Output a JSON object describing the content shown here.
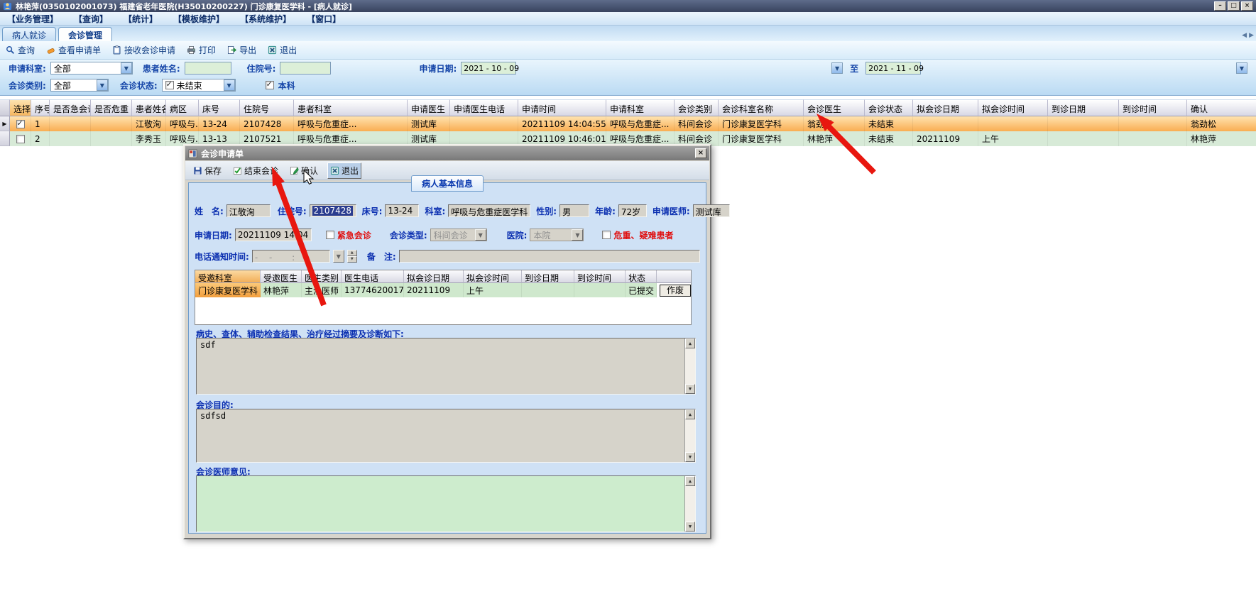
{
  "window": {
    "title": "林艳萍(0350102001073) 福建省老年医院(H35010200227) 门诊康复医学科 - [病人就诊]",
    "controls": {
      "minimize": "–",
      "maximize": "□",
      "close": "×"
    }
  },
  "menu": {
    "items": [
      "【业务管理】",
      "【查询】",
      "【统计】",
      "【模板维护】",
      "【系统维护】",
      "【窗口】"
    ]
  },
  "tabs": {
    "items": [
      {
        "label": "病人就诊"
      },
      {
        "label": "会诊管理"
      }
    ],
    "nav_prev": "◀",
    "nav_next": "▶"
  },
  "toolbar": {
    "buttons": [
      {
        "label": "查询",
        "icon": "search-icon"
      },
      {
        "label": "查看申请单",
        "icon": "view-form-icon"
      },
      {
        "label": "接收会诊申请",
        "icon": "receive-request-icon"
      },
      {
        "label": "打印",
        "icon": "print-icon"
      },
      {
        "label": "导出",
        "icon": "export-icon"
      },
      {
        "label": "退出",
        "icon": "exit-icon"
      }
    ]
  },
  "filters": {
    "apply_dept_label": "申请科室:",
    "apply_dept_value": "全部",
    "patient_name_label": "患者姓名:",
    "patient_name_value": "",
    "admission_no_label": "住院号:",
    "admission_no_value": "",
    "apply_date_label": "申请日期:",
    "date_from": "2021 - 10 - 09",
    "to_label": "至",
    "date_to": "2021 - 11 - 09",
    "consult_class_label": "会诊类别:",
    "consult_class_value": "全部",
    "consult_status_label": "会诊状态:",
    "consult_status_value": "未结束",
    "consult_status_checked": true,
    "own_dept_label": "本科",
    "own_dept_checked": true
  },
  "table": {
    "columns": [
      "选择",
      "序号",
      "是否急会诊",
      "是否危重",
      "患者姓名",
      "病区",
      "床号",
      "住院号",
      "患者科室",
      "申请医生",
      "申请医生电话",
      "申请时间",
      "申请科室",
      "会诊类别",
      "会诊科室名称",
      "会诊医生",
      "会诊状态",
      "拟会诊日期",
      "拟会诊时间",
      "到诊日期",
      "到诊时间",
      "确认"
    ],
    "rows": [
      {
        "checked": true,
        "current": true,
        "cells": [
          "1",
          "",
          "",
          "江敬洵",
          "呼吸与...",
          "13-24",
          "2107428",
          "呼吸与危重症...",
          "测试库",
          "",
          "20211109 14:04:55",
          "呼吸与危重症...",
          "科间会诊",
          "门诊康复医学科",
          "翁劲松",
          "未结束",
          "",
          "",
          "",
          "",
          "翁劲松"
        ]
      },
      {
        "checked": false,
        "current": false,
        "cells": [
          "2",
          "",
          "",
          "李秀玉",
          "呼吸与...",
          "13-13",
          "2107521",
          "呼吸与危重症...",
          "测试库",
          "",
          "20211109 10:46:01",
          "呼吸与危重症...",
          "科间会诊",
          "门诊康复医学科",
          "林艳萍",
          "未结束",
          "20211109",
          "上午",
          "",
          "",
          "林艳萍"
        ]
      }
    ]
  },
  "dialog": {
    "title": "会诊申请单",
    "close_glyph": "×",
    "toolbar": {
      "save": "保存",
      "end": "结束会诊",
      "confirm": "确认",
      "exit": "退出"
    },
    "tab": "病人基本信息",
    "patient": {
      "name_label": "姓　名:",
      "name": "江敬洵",
      "admission_label": "住院号:",
      "admission": "2107428",
      "bed_label": "床号:",
      "bed": "13-24",
      "dept_label": "科室:",
      "dept": "呼吸与危重症医学科",
      "gender_label": "性别:",
      "gender": "男",
      "age_label": "年龄:",
      "age": "72岁",
      "doctor_label": "申请医师:",
      "doctor": "测试库"
    },
    "apply": {
      "date_label": "申请日期:",
      "date": "20211109 14:04",
      "urgent_label": "紧急会诊",
      "urgent_checked": false,
      "type_label": "会诊类型:",
      "type": "科间会诊",
      "hospital_label": "医院:",
      "hospital": "本院",
      "critical_label": "危重、疑难患者",
      "critical_checked": false
    },
    "phone": {
      "label": "电话通知时间:",
      "value": "-　 -　　 :　 :",
      "note_label": "备　注:",
      "note": ""
    },
    "invited": {
      "columns": [
        "受邀科室",
        "受邀医生",
        "医生类别",
        "医生电话",
        "拟会诊日期",
        "拟会诊时间",
        "到诊日期",
        "到诊时间",
        "状态",
        ""
      ],
      "rows": [
        {
          "cells": [
            "门诊康复医学科",
            "林艳萍",
            "主治医师",
            "13774620017",
            "20211109",
            "上午",
            "",
            "",
            "已提交"
          ],
          "action": "作废"
        }
      ]
    },
    "history_label": "病史、查体、辅助检查结果、治疗经过摘要及诊断如下:",
    "history_text": "sdf",
    "purpose_label": "会诊目的:",
    "purpose_text": "sdfsd",
    "opinion_label": "会诊医师意见:",
    "opinion_text": ""
  },
  "colors": {
    "title_bar": "#46536e",
    "accent_blue": "#1545a8",
    "selected_row": "#f9ad52",
    "alt_row": "#d7ead7",
    "field_green": "#dcefd8",
    "label_red": "#e01010",
    "arrow_red": "#e8170f",
    "selection_navy": "#2a3c8f",
    "amber_cell": "#f2a440"
  }
}
